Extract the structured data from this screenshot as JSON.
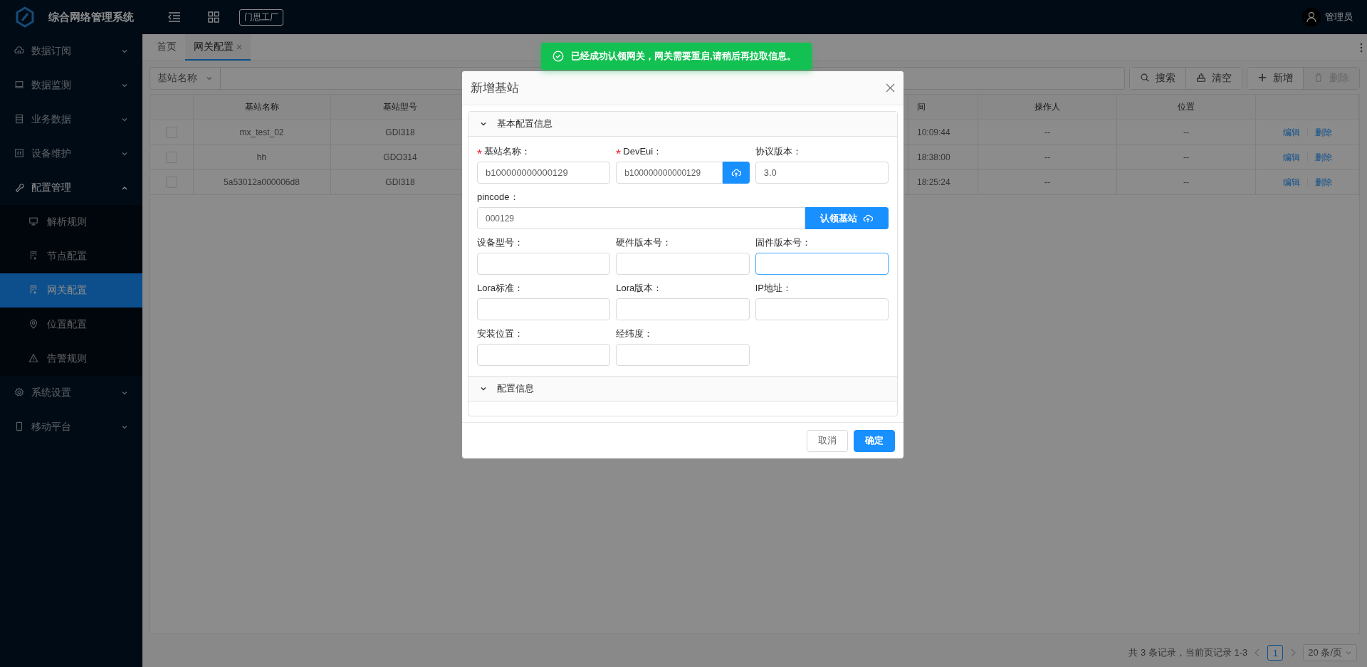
{
  "header": {
    "title": "综合网络管理系统",
    "org_button": "门思工厂",
    "user": "管理员"
  },
  "sidebar": {
    "items": [
      {
        "label": "数据订阅",
        "expanded": false
      },
      {
        "label": "数据监测",
        "expanded": false
      },
      {
        "label": "业务数据",
        "expanded": false
      },
      {
        "label": "设备维护",
        "expanded": false
      },
      {
        "label": "配置管理",
        "expanded": true,
        "children": [
          {
            "label": "解析规则",
            "selected": false
          },
          {
            "label": "节点配置",
            "selected": false
          },
          {
            "label": "网关配置",
            "selected": true
          },
          {
            "label": "位置配置",
            "selected": false
          },
          {
            "label": "告警规则",
            "selected": false
          }
        ]
      },
      {
        "label": "系统设置",
        "expanded": false
      },
      {
        "label": "移动平台",
        "expanded": false
      }
    ]
  },
  "tabs": [
    {
      "label": "首页",
      "selected": false,
      "closable": false
    },
    {
      "label": "网关配置",
      "selected": true,
      "closable": true
    }
  ],
  "toolbar": {
    "filter_field": "基站名称",
    "buttons": [
      {
        "label": "搜索",
        "disabled": false
      },
      {
        "label": "清空",
        "disabled": false
      },
      {
        "label": "新增",
        "disabled": false
      },
      {
        "label": "删除",
        "disabled": true
      }
    ]
  },
  "table": {
    "columns": [
      "基站名称",
      "基站型号",
      "间",
      "操作人",
      "位置"
    ],
    "rows": [
      {
        "checked": false,
        "name": "mx_test_02",
        "model": "GDI318",
        "time": "10:09:44",
        "operator": "--",
        "location": "--",
        "actions": [
          "编辑",
          "删除"
        ]
      },
      {
        "checked": false,
        "name": "hh",
        "model": "GDO314",
        "time": "18:38:00",
        "operator": "--",
        "location": "--",
        "actions": [
          "编辑",
          "删除"
        ]
      },
      {
        "checked": false,
        "name": "5a53012a000006d8",
        "model": "GDI318",
        "time": "18:25:24",
        "operator": "--",
        "location": "--",
        "actions": [
          "编辑",
          "删除"
        ]
      }
    ]
  },
  "pagination": {
    "summary": "共 3 条记录，当前页记录 1-3",
    "pages": [
      {
        "label": "1",
        "selected": true
      }
    ],
    "page_size": "20 条/页"
  },
  "toast": {
    "message": "已经成功认领网关，网关需要重启,请稍后再拉取信息。"
  },
  "dialog": {
    "title": "新增基站",
    "sections": [
      {
        "title": "基本配置信息",
        "expanded": true,
        "fields": [
          {
            "label": "基站名称：",
            "required": true,
            "kind": "input",
            "value": "b100000000000129",
            "focused": false
          },
          {
            "label": "DevEui：",
            "required": true,
            "kind": "input-icon-button",
            "value": "b100000000000129",
            "focused": false
          },
          {
            "label": "协议版本：",
            "required": false,
            "kind": "input",
            "value": "3.0",
            "focused": false
          },
          {
            "label": "pincode：",
            "required": false,
            "kind": "input-text-button",
            "value": "000129",
            "button": "认领基站",
            "focused": false
          },
          {
            "label": "设备型号：",
            "required": false,
            "kind": "input",
            "focused": false
          },
          {
            "label": "硬件版本号：",
            "required": false,
            "kind": "input",
            "focused": false
          },
          {
            "label": "固件版本号：",
            "required": false,
            "kind": "input",
            "focused": true
          },
          {
            "label": "Lora标准：",
            "required": false,
            "kind": "input",
            "focused": false
          },
          {
            "label": "Lora版本：",
            "required": false,
            "kind": "input",
            "focused": false
          },
          {
            "label": "IP地址：",
            "required": false,
            "kind": "input",
            "focused": false
          },
          {
            "label": "安装位置：",
            "required": false,
            "kind": "input",
            "focused": false
          },
          {
            "label": "经纬度：",
            "required": false,
            "kind": "input",
            "focused": false
          }
        ]
      },
      {
        "title": "配置信息",
        "expanded": true
      }
    ],
    "buttons": [
      {
        "label": "取消",
        "kind": "default"
      },
      {
        "label": "确定",
        "kind": "primary"
      }
    ]
  }
}
